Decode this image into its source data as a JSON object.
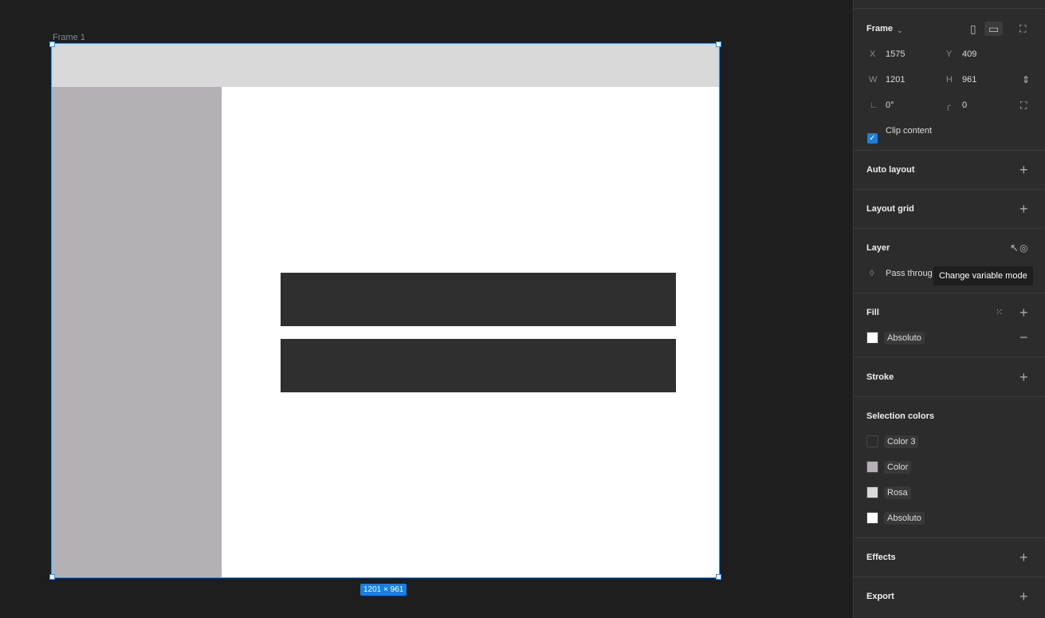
{
  "canvas": {
    "frame_name": "Frame 1",
    "size_badge": "1201 × 961"
  },
  "panel": {
    "frame": {
      "title": "Frame",
      "x_label": "X",
      "x": "1575",
      "y_label": "Y",
      "y": "409",
      "w_label": "W",
      "w": "1201",
      "h_label": "H",
      "h": "961",
      "rotation": "0°",
      "radius": "0",
      "clip_content": "Clip content",
      "clip_checked": true
    },
    "auto_layout": "Auto layout",
    "layout_grid": "Layout grid",
    "layer": {
      "title": "Layer",
      "blend": "Pass throug",
      "tooltip": "Change variable mode"
    },
    "fill": {
      "title": "Fill",
      "color": "#ffffff",
      "name": "Absoluto"
    },
    "stroke": "Stroke",
    "selection_colors": {
      "title": "Selection colors",
      "items": [
        {
          "name": "Color 3",
          "color": "#2c2c2c"
        },
        {
          "name": "Color",
          "color": "#b3b1b3"
        },
        {
          "name": "Rosa",
          "color": "#d9d9d9"
        },
        {
          "name": "Absoluto",
          "color": "#ffffff"
        }
      ]
    },
    "effects": "Effects",
    "export": "Export"
  }
}
